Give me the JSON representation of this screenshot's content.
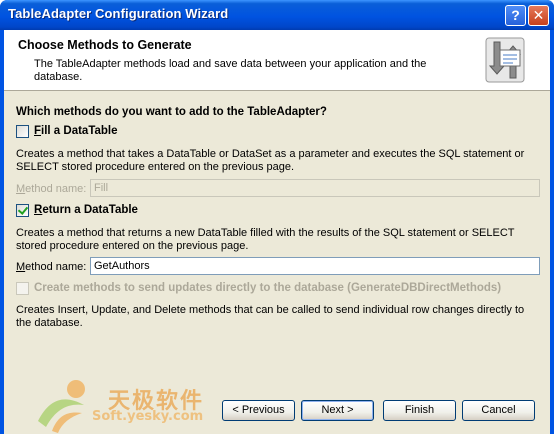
{
  "window": {
    "title": "TableAdapter Configuration Wizard",
    "help_glyph": "?",
    "close_glyph": "✕"
  },
  "header": {
    "title": "Choose Methods to Generate",
    "description": "The TableAdapter methods load and save data between your application and the database.",
    "icon": "table-adapter-methods-icon"
  },
  "question": "Which methods do you want to add to the TableAdapter?",
  "fill_datatable": {
    "checked": false,
    "label_first": "F",
    "label_rest": "ill a DataTable",
    "description": "Creates a method that takes a DataTable or DataSet as a parameter and executes the SQL statement or SELECT stored procedure entered on the previous page.",
    "method_label_first": "M",
    "method_label_rest": "ethod name:",
    "method_value": "Fill",
    "enabled": false
  },
  "return_datatable": {
    "checked": true,
    "label_first": "R",
    "label_rest": "eturn a DataTable",
    "description": "Creates a method that returns a new DataTable filled with the results of the SQL statement or SELECT stored procedure entered on the previous page.",
    "method_label_first": "M",
    "method_label_rest": "ethod name:",
    "method_value": "GetAuthors",
    "enabled": true
  },
  "direct_methods": {
    "checked": false,
    "enabled": false,
    "label": "Create methods to send updates directly to the database (GenerateDBDirectMethods)",
    "description": "Creates Insert, Update, and Delete methods that can be called to send individual row changes directly to the database."
  },
  "buttons": {
    "previous": "< Previous",
    "next": "Next >",
    "finish": "Finish",
    "cancel": "Cancel"
  },
  "watermark": {
    "text": "天极软件",
    "sub": "Soft.yesky.com"
  },
  "colors": {
    "titlebar": "#0054e3",
    "dialog_bg": "#ece9d8",
    "checkmark": "#21a121"
  }
}
